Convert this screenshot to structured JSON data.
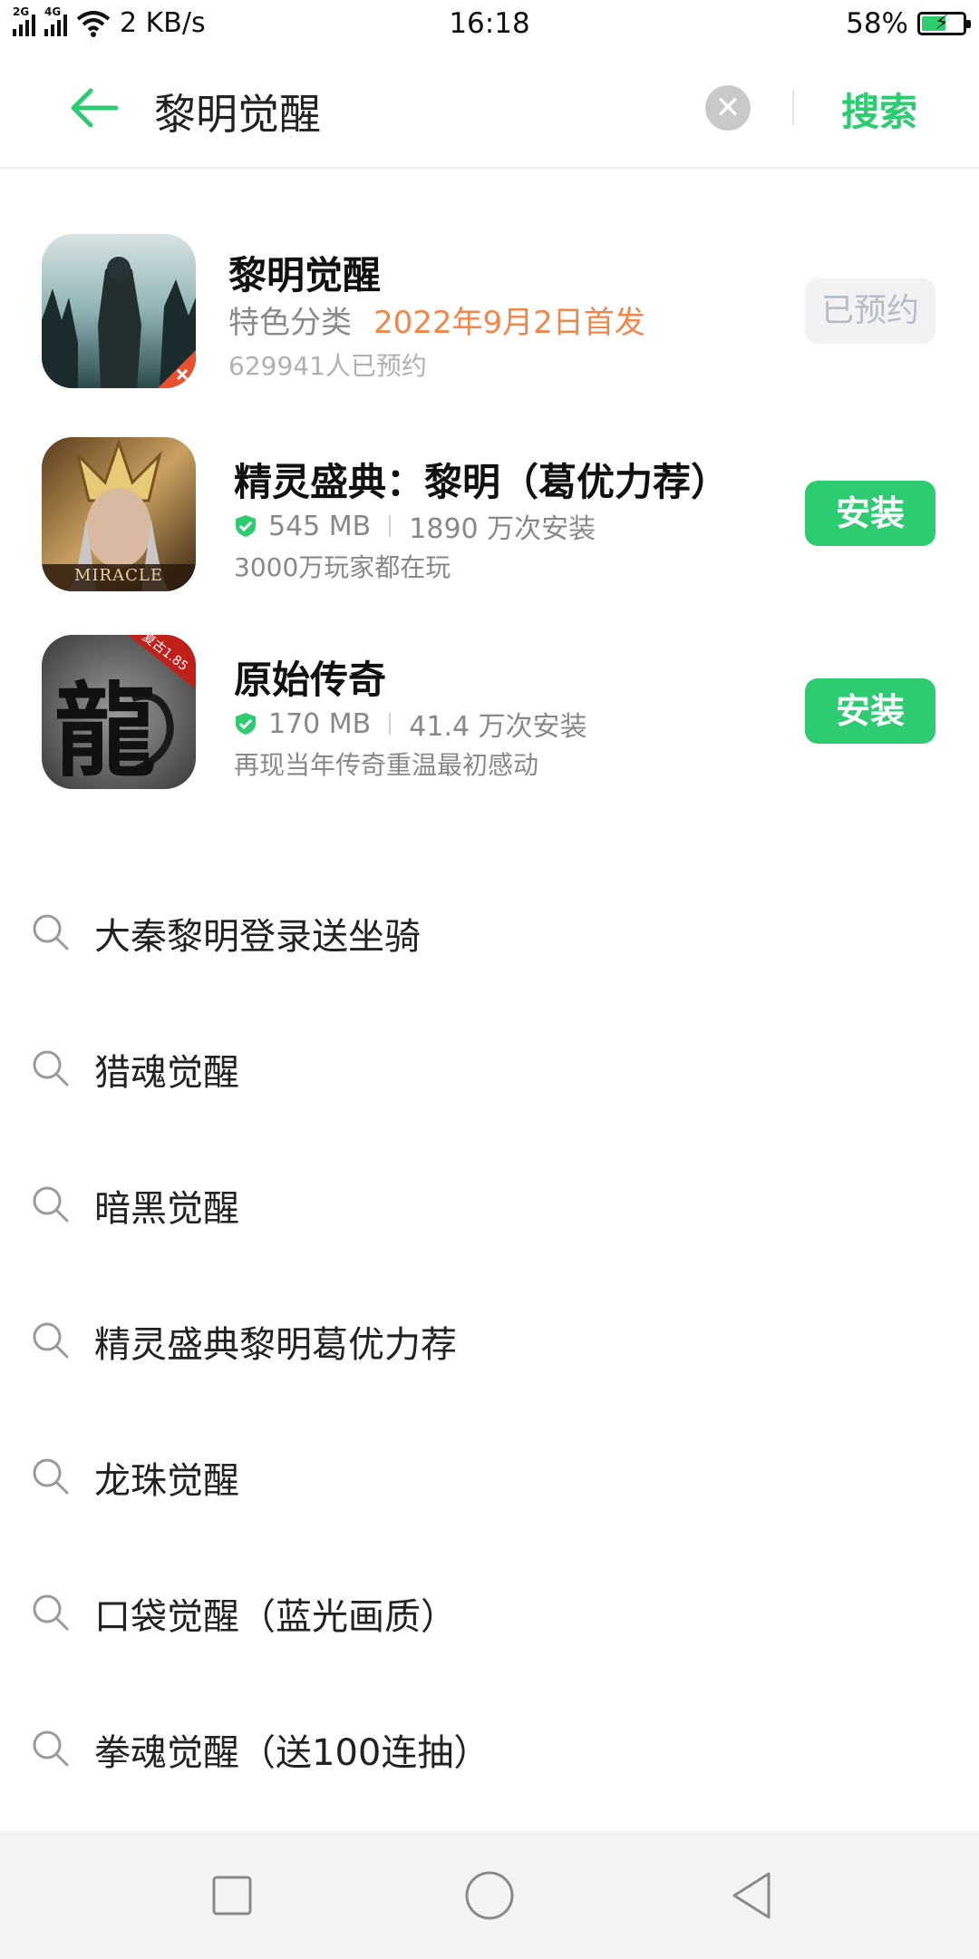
{
  "status_bar": {
    "net_2g": "2G",
    "net_4g": "4G",
    "speed": "2 KB/s",
    "time": "16:18",
    "battery_percent": "58%",
    "battery_level": 0.58
  },
  "search": {
    "query": "黎明觉醒",
    "submit_label": "搜索"
  },
  "apps": [
    {
      "name": "黎明觉醒",
      "category": "特色分类",
      "release": "2022年9月2日首发",
      "reservations": "629941人已预约",
      "action": "已预约"
    },
    {
      "name": "精灵盛典：黎明（葛优力荐）",
      "size": "545 MB",
      "installs": "1890 万次安装",
      "desc": "3000万玩家都在玩",
      "action": "安装",
      "icon_text": "MIRACLE"
    },
    {
      "name": "原始传奇",
      "size": "170 MB",
      "installs": "41.4 万次安装",
      "desc": "再现当年传奇重温最初感动",
      "action": "安装",
      "icon_glyph": "龍",
      "icon_ribbon": "复古1.85"
    }
  ],
  "suggestions": [
    "大秦黎明登录送坐骑",
    "猎魂觉醒",
    "暗黑觉醒",
    "精灵盛典黎明葛优力荐",
    "龙珠觉醒",
    "口袋觉醒（蓝光画质）",
    "拳魂觉醒（送100连抽）"
  ],
  "colors": {
    "accent": "#2ecc71",
    "date": "#f2854a"
  }
}
